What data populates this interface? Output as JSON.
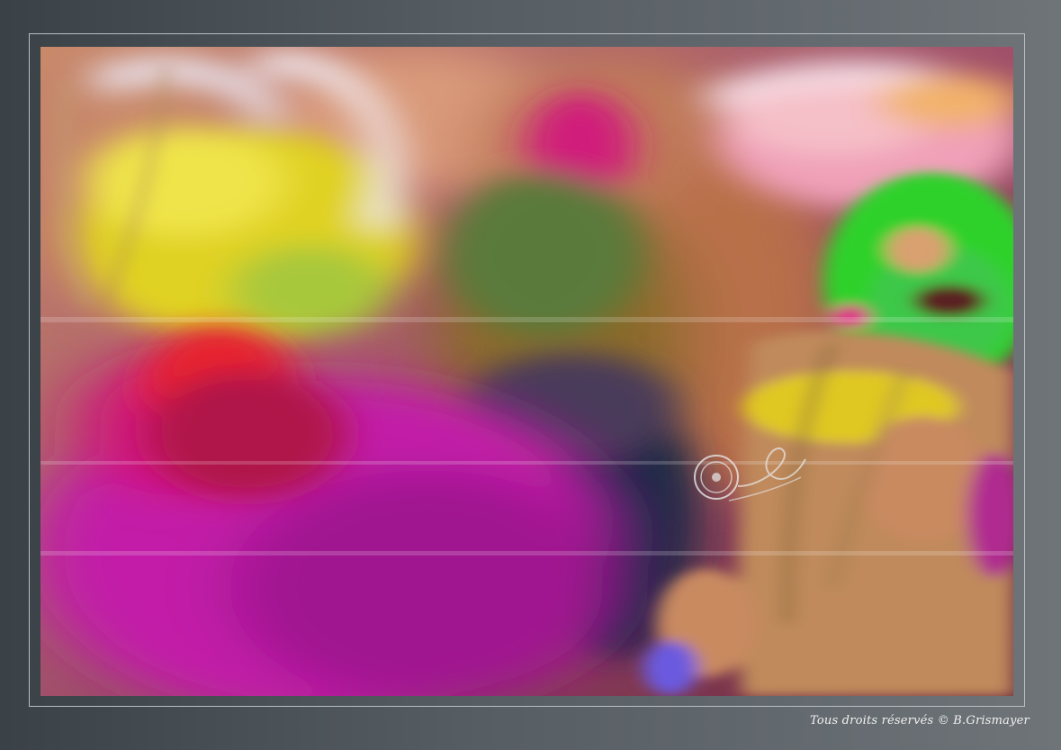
{
  "photo": {
    "subject": "motion-blurred crowd at colour festival",
    "dominant_colors": [
      "#c21ea8",
      "#e0d220",
      "#2fd12a",
      "#e23a55",
      "#c98a5c",
      "#1e3a5a"
    ]
  },
  "watermark": {
    "icon": "copyright-seal-icon",
    "color": "#e8e8e8"
  },
  "credit": {
    "text": "Tous droits réservés © B.Grismayer"
  }
}
